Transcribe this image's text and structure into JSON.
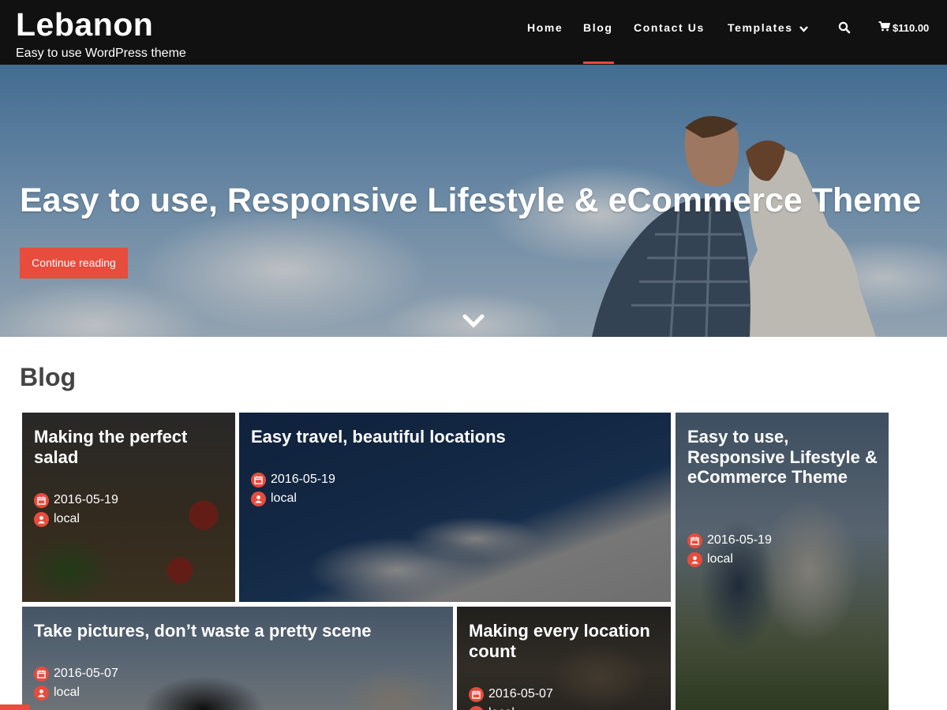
{
  "header": {
    "site_title": "Lebanon",
    "tagline": "Easy to use WordPress theme",
    "nav": [
      {
        "label": "Home"
      },
      {
        "label": "Blog"
      },
      {
        "label": "Contact Us"
      },
      {
        "label": "Templates"
      }
    ],
    "cart_total": "$110.00",
    "icons": {
      "search": "search-icon",
      "cart": "cart-icon",
      "dropdown": "chevron-down-icon"
    }
  },
  "hero": {
    "title": "Easy to use, Responsive Lifestyle & eCommerce Theme",
    "button_label": "Continue reading",
    "scroll_icon": "chevron-down-icon"
  },
  "blog": {
    "heading": "Blog",
    "posts": [
      {
        "title": "Making the perfect salad",
        "date": "2016-05-19",
        "author": "local"
      },
      {
        "title": "Easy travel, beautiful locations",
        "date": "2016-05-19",
        "author": "local"
      },
      {
        "title": "Easy to use, Responsive Lifestyle & eCommerce Theme",
        "date": "2016-05-19",
        "author": "local"
      },
      {
        "title": "Take pictures, don’t waste a pretty scene",
        "date": "2016-05-07",
        "author": "local"
      },
      {
        "title": "Making every location count",
        "date": "2016-05-07",
        "author": "local"
      }
    ]
  },
  "colors": {
    "accent": "#e74c3c",
    "header_bg": "#111111",
    "heading_text": "#444444"
  }
}
